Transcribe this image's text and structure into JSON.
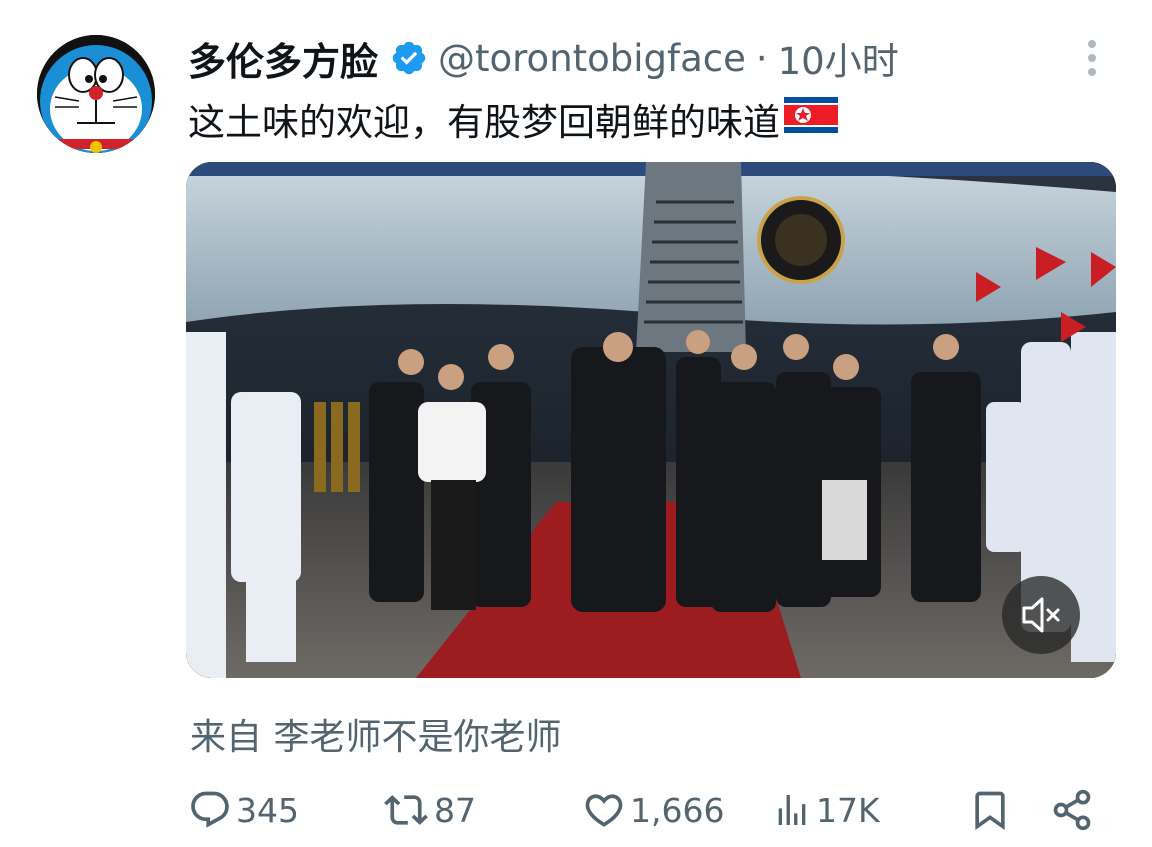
{
  "tweet": {
    "display_name": "多伦多方脸",
    "handle": "@torontobigface",
    "separator": "·",
    "time": "10小时",
    "text": "这土味的欢迎，有股梦回朝鲜的味道",
    "flag_emoji": "north-korea-flag",
    "source_label": "来自 李老师不是你老师",
    "avatar_icon": "doraemon-avatar",
    "verified_icon": "verified-badge-icon",
    "more_icon": "more-vertical-icon"
  },
  "media": {
    "type": "video",
    "mute_icon": "speaker-muted-icon"
  },
  "actions": {
    "replies": "345",
    "retweets": "87",
    "likes": "1,666",
    "views": "17K"
  },
  "colors": {
    "text_primary": "#0f1419",
    "text_secondary": "#536471",
    "verified_blue": "#1d9bf0",
    "carpet_red": "#9d1c1f"
  }
}
